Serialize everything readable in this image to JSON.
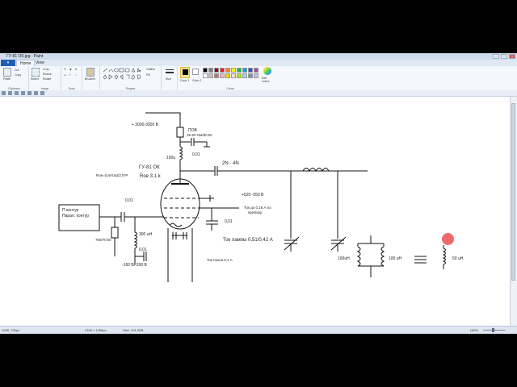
{
  "window": {
    "title": "ГУ-81 ОК.jpg - Paint"
  },
  "ribbon_tabs": {
    "file": "",
    "home": "Home",
    "view": "View"
  },
  "ribbon": {
    "clipboard": {
      "paste": "Paste",
      "cut": "Cut",
      "copy": "Copy",
      "label": "Clipboard"
    },
    "image": {
      "select": "Select",
      "crop": "Crop",
      "resize": "Resize",
      "rotate": "Rotate",
      "label": "Image"
    },
    "tools": {
      "label": "Tools"
    },
    "brushes": {
      "label": "Brushes"
    },
    "shapes": {
      "outline": "Outline",
      "fill": "Fill",
      "label": "Shapes"
    },
    "size": {
      "label": "Size"
    },
    "colors": {
      "color1": "Color 1",
      "color2": "Color 2",
      "edit": "Edit colors",
      "label": "Colors"
    },
    "palette": [
      "#000000",
      "#7f7f7f",
      "#880015",
      "#ed1c24",
      "#ff7f27",
      "#fff200",
      "#22b14c",
      "#00a2e8",
      "#3f48cc",
      "#a349a4",
      "#ffffff",
      "#c3c3c3",
      "#b97a57",
      "#ffaec9",
      "#ffc90e",
      "#efe4b0",
      "#b5e61d",
      "#99d9ea",
      "#7092be",
      "#c8bfe7"
    ],
    "color1_value": "#ffb000"
  },
  "diagram": {
    "supply": "+ 3000-3200 В",
    "resistor_pov": "ПОВ",
    "resistor_spec": "35-50 Ом/50 Вт",
    "cap_001_top": "0,01",
    "choke_100u": "100u",
    "tube_name": "ГУ-81  ОК",
    "roe_formula": "Roe=(Ua*Ua)/2.5*P",
    "roe_value": "Roe 3.1 k",
    "coupling_cap": "2N - 4N",
    "screen_voltage": "+520 -550 В",
    "screen_note_1": "Ток до 0,18 А по",
    "screen_note_2": "прибору.",
    "cap_001_screen": "0,01",
    "input_box_1": "П контур",
    "input_box_2": "Парал. контур",
    "cap_001_input": "0,01",
    "resistor_700": "700/70 Вт",
    "choke_100uh": "300 uH",
    "bias": "-160 В/-200 В",
    "cap_001_bias": "0,01",
    "lamp_current": "Ток лампы 0,51/0,42 А",
    "idle_current": "Ток покоя 0,1 А",
    "coil_a": "100uH",
    "coil_b": "100 uH",
    "coil_eq": "50 uH"
  },
  "status": {
    "cursor": "1008, 726px",
    "selection": "2106 × 1260px",
    "size": "Size: 101,2KB",
    "zoom": "100%"
  }
}
